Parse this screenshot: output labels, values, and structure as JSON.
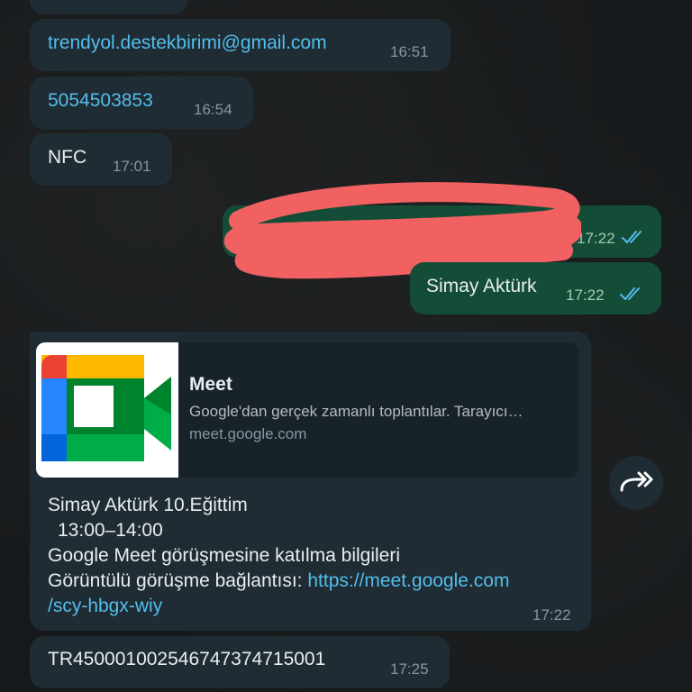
{
  "messages": [
    {
      "text": "trendyol.destekbirimi@gmail.com",
      "time": "16:51"
    },
    {
      "text": "5054503853",
      "time": "16:54"
    },
    {
      "text": "NFC",
      "time": "17:01"
    },
    {
      "text": "",
      "time": "17:22"
    },
    {
      "text": "Simay Aktürk",
      "time": "17:22"
    }
  ],
  "meet_card": {
    "preview_title": "Meet",
    "preview_description": "Google'dan gerçek zamanlı toplantılar. Tarayıcı…",
    "preview_domain": "meet.google.com",
    "line1": "Simay Aktürk 10.Eğittim",
    "line2": "13:00–14:00",
    "line3": "Google Meet görüşmesine katılma bilgileri",
    "line4_prefix": "Görüntülü görüşme bağlantısı: ",
    "link_part1": "https://meet.google.com",
    "link_part2": "/scy-hbgx-wiy",
    "time": "17:22"
  },
  "last_message": {
    "text": "TR450001002546747374715001",
    "time": "17:25"
  },
  "icons": {
    "read_receipt": "double-check-icon",
    "forward": "forward-icon",
    "meet_logo": "google-meet-logo"
  },
  "colors": {
    "incoming_bubble": "#1f2c34",
    "outgoing_bubble": "#134d37",
    "link": "#53bdeb",
    "read_tick": "#53bdeb",
    "scribble": "#f26161"
  }
}
